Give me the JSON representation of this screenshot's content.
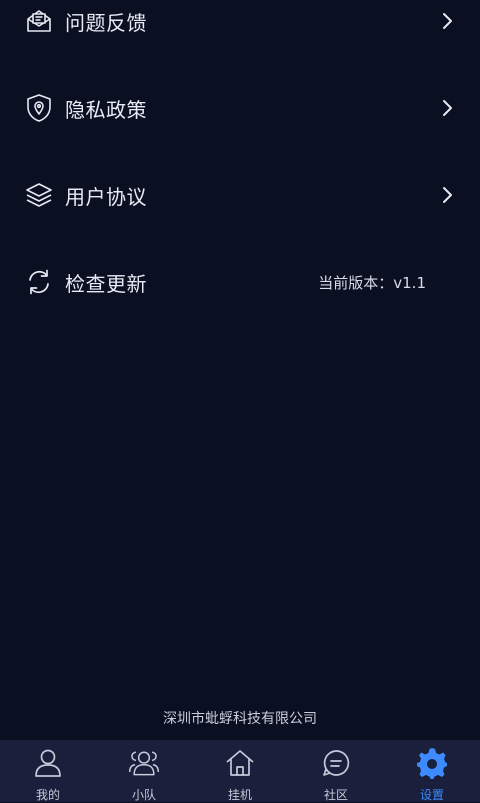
{
  "menu": {
    "items": [
      {
        "label": "问题反馈",
        "icon": "envelope-icon"
      },
      {
        "label": "隐私政策",
        "icon": "shield-location-icon"
      },
      {
        "label": "用户协议",
        "icon": "layers-icon"
      },
      {
        "label": "检查更新",
        "icon": "refresh-icon",
        "version": "当前版本：v1.1"
      }
    ]
  },
  "footer": {
    "company": "深圳市蚍蜉科技有限公司"
  },
  "tabbar": {
    "tabs": [
      {
        "label": "我的",
        "icon": "user-icon"
      },
      {
        "label": "小队",
        "icon": "team-icon"
      },
      {
        "label": "挂机",
        "icon": "home-icon"
      },
      {
        "label": "社区",
        "icon": "chat-icon"
      },
      {
        "label": "设置",
        "icon": "gear-icon",
        "active": true
      }
    ],
    "active_color": "#3d8bff"
  }
}
